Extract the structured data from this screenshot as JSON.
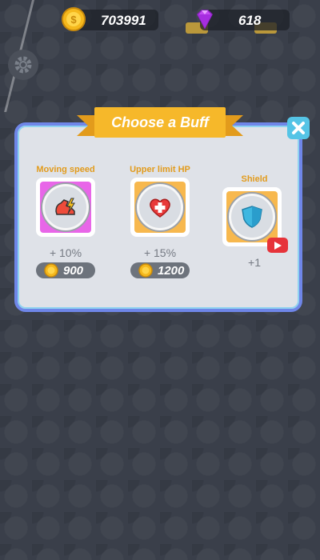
{
  "currency": {
    "coins": "703991",
    "gems": "618"
  },
  "popup": {
    "title": "Choose a Buff",
    "buffs": [
      {
        "name": "Moving speed",
        "bonus": "+ 10%",
        "price": "900",
        "icon": "running-shoe-icon"
      },
      {
        "name": "Upper limit HP",
        "bonus": "+ 15%",
        "price": "1200",
        "icon": "heart-icon"
      },
      {
        "name": "Shield",
        "bonus": "+1",
        "icon": "shield-icon",
        "unlock": "video-ad"
      }
    ]
  },
  "colors": {
    "panel_border": "#6f86e8",
    "ribbon": "#f6b82a",
    "buff_name": "#e29b1c",
    "close_button": "#55c4e6",
    "video_badge": "#e6333a"
  }
}
